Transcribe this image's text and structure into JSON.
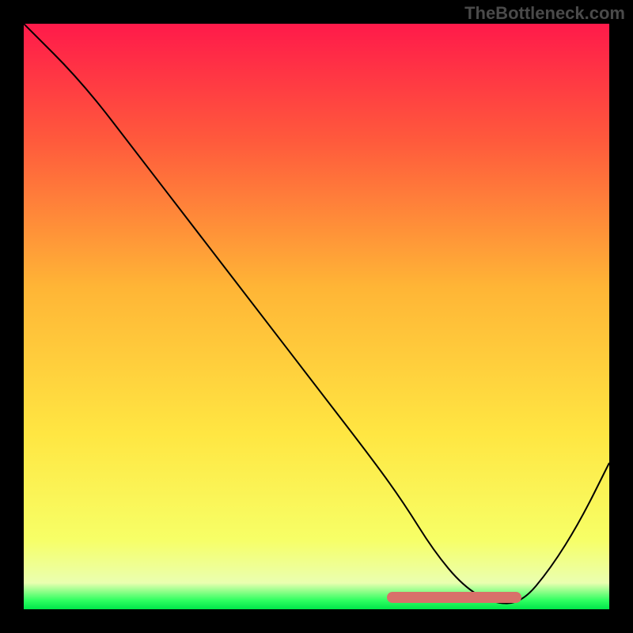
{
  "watermark": "TheBottleneck.com",
  "chart_data": {
    "type": "line",
    "title": "",
    "xlabel": "",
    "ylabel": "",
    "x_range": [
      0,
      100
    ],
    "y_range": [
      0,
      100
    ],
    "series": [
      {
        "name": "curve",
        "x": [
          0,
          10,
          20,
          30,
          40,
          50,
          60,
          65,
          70,
          75,
          80,
          85,
          90,
          95,
          100
        ],
        "y": [
          100,
          90,
          77,
          64,
          51,
          38,
          25,
          18,
          10,
          4,
          1,
          1,
          7,
          15,
          25
        ]
      }
    ],
    "highlight_band": {
      "x_start": 62,
      "x_end": 85,
      "y": 2
    },
    "gradient_stops": [
      {
        "offset": 0.0,
        "color": "#ff1a4a"
      },
      {
        "offset": 0.2,
        "color": "#ff5a3c"
      },
      {
        "offset": 0.45,
        "color": "#ffb536"
      },
      {
        "offset": 0.7,
        "color": "#ffe642"
      },
      {
        "offset": 0.88,
        "color": "#f7ff66"
      },
      {
        "offset": 0.955,
        "color": "#eaffb0"
      },
      {
        "offset": 0.985,
        "color": "#2eff60"
      },
      {
        "offset": 1.0,
        "color": "#00e64a"
      }
    ]
  }
}
